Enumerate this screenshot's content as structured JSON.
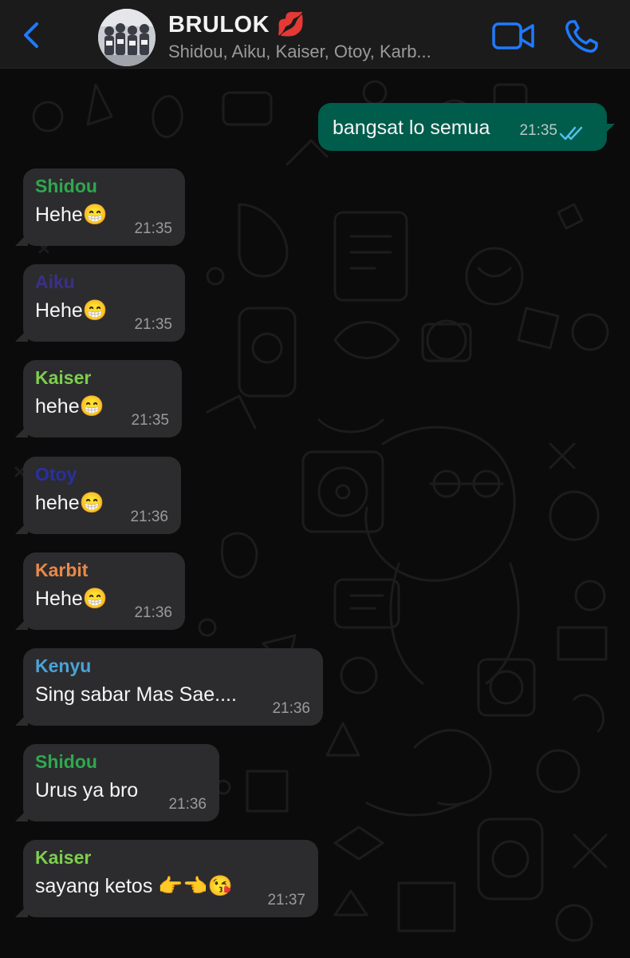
{
  "header": {
    "back_icon": "chevron-left-icon",
    "title": "BRULOK 💋",
    "subtitle": "Shidou, Aiku, Kaiser, Otoy, Karb...",
    "video_icon": "video-camera-icon",
    "call_icon": "phone-icon",
    "accent_color": "#1f7aff"
  },
  "messages": [
    {
      "direction": "outgoing",
      "text": "bangsat lo semua",
      "time": "21:35",
      "status_icon": "double-check-icon"
    },
    {
      "direction": "incoming",
      "sender": "Shidou",
      "sender_color": "#2fa84f",
      "text": "Hehe😁",
      "time": "21:35"
    },
    {
      "direction": "incoming",
      "sender": "Aiku",
      "sender_color": "#3a2f8a",
      "text": "Hehe😁",
      "time": "21:35"
    },
    {
      "direction": "incoming",
      "sender": "Kaiser",
      "sender_color": "#7ccf4e",
      "text": "hehe😁",
      "time": "21:35"
    },
    {
      "direction": "incoming",
      "sender": "Otoy",
      "sender_color": "#2a2fa0",
      "text": "hehe😁",
      "time": "21:36"
    },
    {
      "direction": "incoming",
      "sender": "Karbit",
      "sender_color": "#e8894a",
      "text": "Hehe😁",
      "time": "21:36"
    },
    {
      "direction": "incoming",
      "sender": "Kenyu",
      "sender_color": "#4aa3d8",
      "text": "Sing sabar Mas Sae....",
      "time": "21:36"
    },
    {
      "direction": "incoming",
      "sender": "Shidou",
      "sender_color": "#2fa84f",
      "text": "Urus ya bro",
      "time": "21:36"
    },
    {
      "direction": "incoming",
      "sender": "Kaiser",
      "sender_color": "#7ccf4e",
      "text": "sayang ketos 👉👈😘",
      "time": "21:37"
    }
  ],
  "colors": {
    "incoming_bubble": "#2c2c2e",
    "outgoing_bubble": "#005c4b",
    "read_ticks": "#53bdeb",
    "background": "#0b0b0b"
  }
}
